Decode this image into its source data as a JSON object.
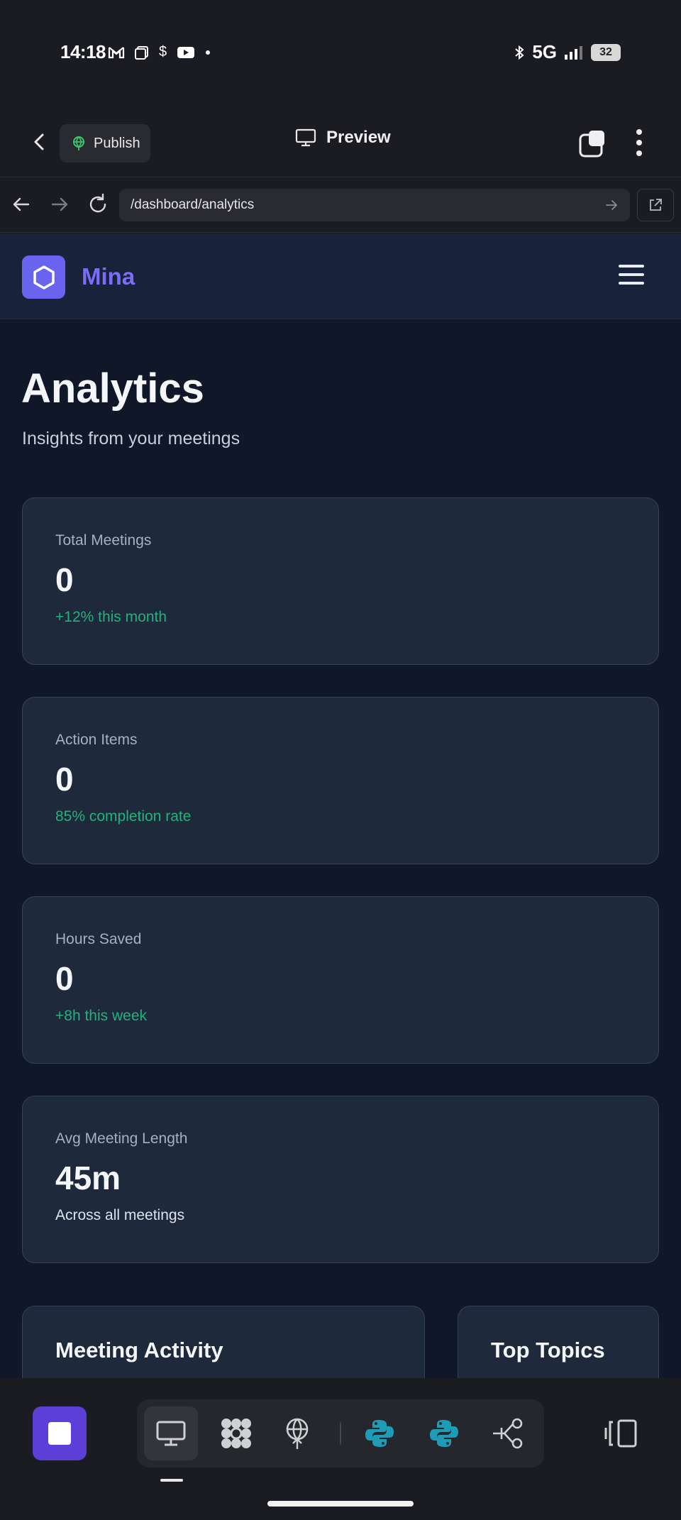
{
  "status_bar": {
    "time": "14:18",
    "network": "5G",
    "battery": "32"
  },
  "toolbar": {
    "publish_label": "Publish",
    "preview_label": "Preview"
  },
  "browser": {
    "url": "/dashboard/analytics"
  },
  "site": {
    "brand": "Mina"
  },
  "page": {
    "title": "Analytics",
    "subtitle": "Insights from your meetings"
  },
  "stats": [
    {
      "label": "Total Meetings",
      "value": "0",
      "note": "+12% this month",
      "note_color": "#22b27a"
    },
    {
      "label": "Action Items",
      "value": "0",
      "note": "85% completion rate",
      "note_color": "#22b27a"
    },
    {
      "label": "Hours Saved",
      "value": "0",
      "note": "+8h this week",
      "note_color": "#22b27a"
    },
    {
      "label": "Avg Meeting Length",
      "value": "45m",
      "note": "Across all meetings",
      "note_color": "#dde3ec"
    }
  ],
  "panels": {
    "meeting_activity": "Meeting Activity",
    "top_topics": "Top Topics"
  },
  "colors": {
    "accent": "#6a63f0",
    "brand_text": "#7b6ef6",
    "positive": "#22b27a",
    "page_bg": "#0f1729",
    "card_bg": "#1e293b"
  },
  "icons": {
    "status_left": [
      "gmail-icon",
      "notes-icon",
      "dollar-icon",
      "youtube-icon",
      "dot-icon"
    ],
    "dock": [
      "desktop-icon",
      "apps-grid-icon",
      "deploy-icon",
      "python-icon",
      "python-icon",
      "share-graph-icon"
    ]
  }
}
